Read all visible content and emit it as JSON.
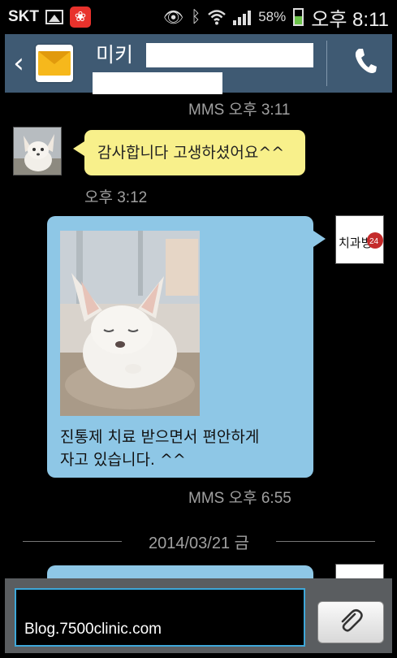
{
  "status_bar": {
    "carrier": "SKT",
    "battery_percent": "58%",
    "time": "오후 8:11",
    "icons": [
      "picture-icon",
      "app-icon",
      "eye-icon",
      "bluetooth-icon",
      "wifi-icon",
      "signal-icon",
      "battery-icon"
    ]
  },
  "header": {
    "contact_name": "미키",
    "icons": [
      "back-arrow-icon",
      "message-envelope-icon",
      "phone-icon"
    ]
  },
  "messages": [
    {
      "meta": "MMS 오후 3:11"
    },
    {
      "direction": "incoming",
      "text": "감사합니다 고생하셨어요^^",
      "time": "오후 3:12"
    },
    {
      "direction": "outgoing",
      "type": "mms",
      "text": "진통제  치료 받으면서 편안하게\n자고 있습니다. ^^",
      "time": "MMS 오후 6:55"
    }
  ],
  "date_divider": "2014/03/21 금",
  "outgoing_avatar_text": "치과병원 24",
  "input": {
    "value": "Blog.7500clinic.com",
    "attach_icon": "paperclip-icon"
  },
  "colors": {
    "header_bg": "#3f5a73",
    "incoming_bubble": "#f8f08b",
    "outgoing_bubble": "#8ec7e6",
    "input_border": "#3ea7d9"
  }
}
